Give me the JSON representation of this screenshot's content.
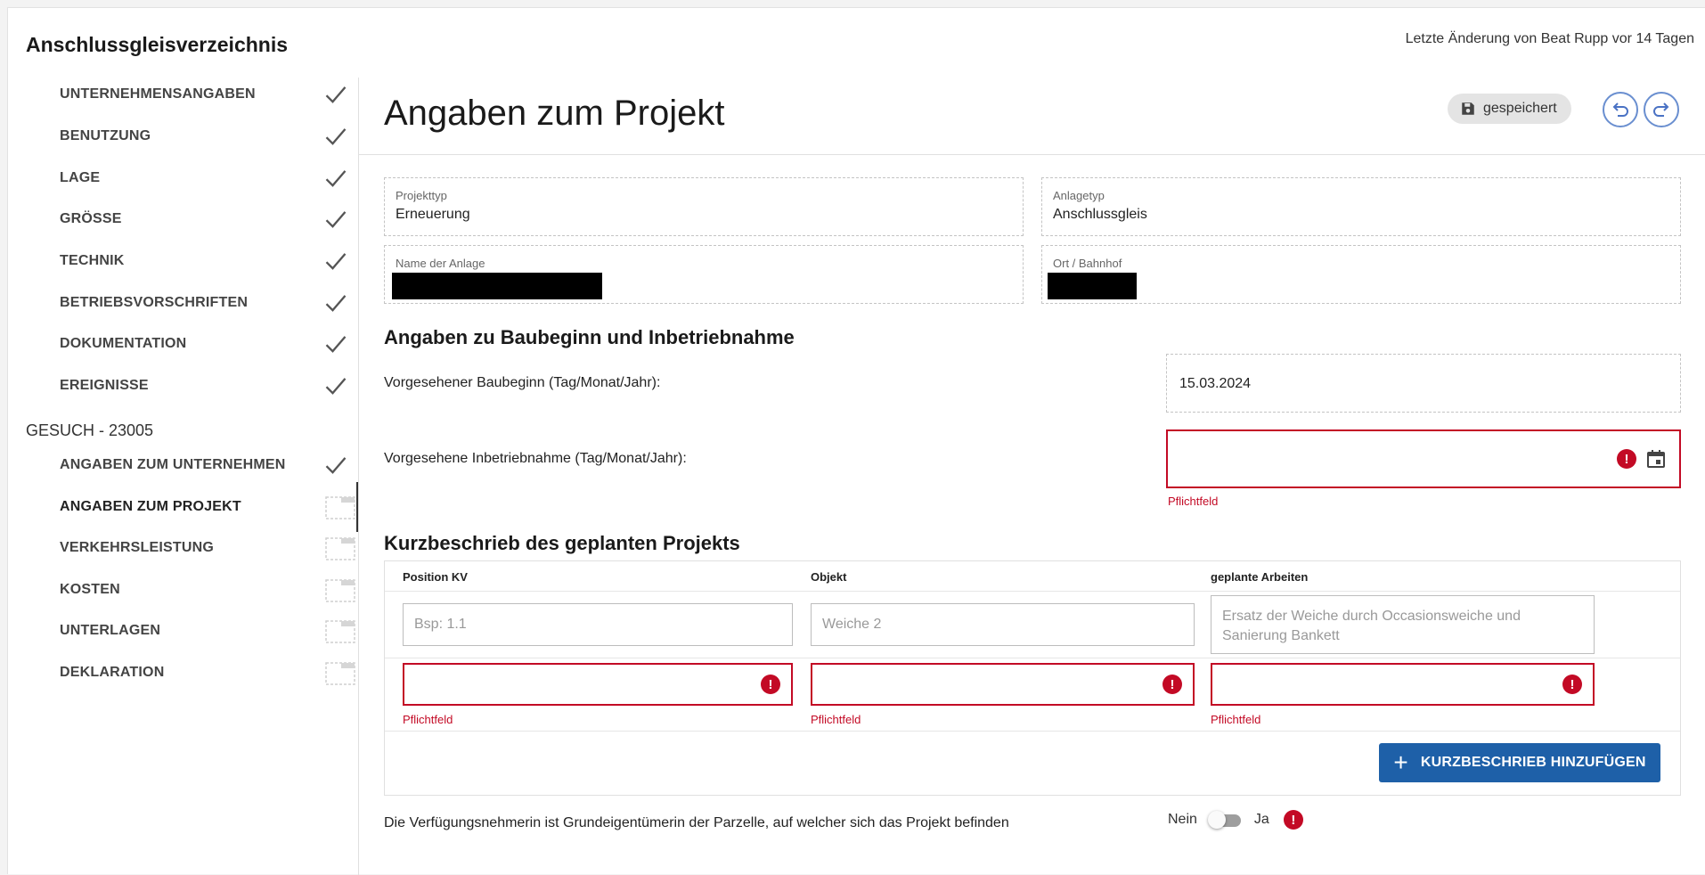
{
  "header": {
    "app_title": "Anschlussgleisverzeichnis",
    "last_change": "Letzte Änderung von Beat Rupp vor 14 Tagen"
  },
  "sidebar": {
    "items": [
      {
        "label": "UNTERNEHMENSANGABEN",
        "status": "done"
      },
      {
        "label": "BENUTZUNG",
        "status": "done"
      },
      {
        "label": "LAGE",
        "status": "done"
      },
      {
        "label": "GRÖSSE",
        "status": "done"
      },
      {
        "label": "TECHNIK",
        "status": "done"
      },
      {
        "label": "BETRIEBSVORSCHRIFTEN",
        "status": "done"
      },
      {
        "label": "DOKUMENTATION",
        "status": "done"
      },
      {
        "label": "EREIGNISSE",
        "status": "done"
      }
    ],
    "section_label": "GESUCH - 23005",
    "gesuch_items": [
      {
        "label": "ANGABEN ZUM UNTERNEHMEN",
        "status": "done"
      },
      {
        "label": "ANGABEN ZUM PROJEKT",
        "status": "active"
      },
      {
        "label": "VERKEHRSLEISTUNG",
        "status": "pending"
      },
      {
        "label": "KOSTEN",
        "status": "pending"
      },
      {
        "label": "UNTERLAGEN",
        "status": "pending"
      },
      {
        "label": "DEKLARATION",
        "status": "pending"
      }
    ]
  },
  "main": {
    "title": "Angaben zum Projekt",
    "saved_label": "gespeichert",
    "fields": {
      "projekttyp": {
        "label": "Projekttyp",
        "value": "Erneuerung"
      },
      "anlagetyp": {
        "label": "Anlagetyp",
        "value": "Anschlussgleis"
      },
      "name_anlage": {
        "label": "Name der Anlage"
      },
      "ort_bahnhof": {
        "label": "Ort / Bahnhof"
      }
    },
    "schedule": {
      "heading": "Angaben zu Baubeginn und Inbetriebnahme",
      "baubeginn_label": "Vorgesehener Baubeginn (Tag/Monat/Jahr):",
      "baubeginn_value": "15.03.2024",
      "inbetrieb_label": "Vorgesehene Inbetriebnahme (Tag/Monat/Jahr):",
      "required_text": "Pflichtfeld"
    },
    "kurzbeschrieb": {
      "heading": "Kurzbeschrieb des geplanten Projekts",
      "columns": [
        "Position KV",
        "Objekt",
        "geplante Arbeiten"
      ],
      "example_row": [
        "Bsp: 1.1",
        "Weiche 2",
        "Ersatz der Weiche durch Occasionsweiche und Sanierung Bankett"
      ],
      "required_text": "Pflichtfeld",
      "add_button": "KURZBESCHRIEB HINZUFÜGEN"
    },
    "owner": {
      "question": "Die Verfügungsnehmerin ist Grundeigentümerin der Parzelle, auf welcher sich das Projekt befinden",
      "no_label": "Nein",
      "yes_label": "Ja"
    }
  },
  "colors": {
    "error": "#c30a25",
    "primary": "#1e60a8",
    "accent_outline": "#6a8fd0"
  }
}
